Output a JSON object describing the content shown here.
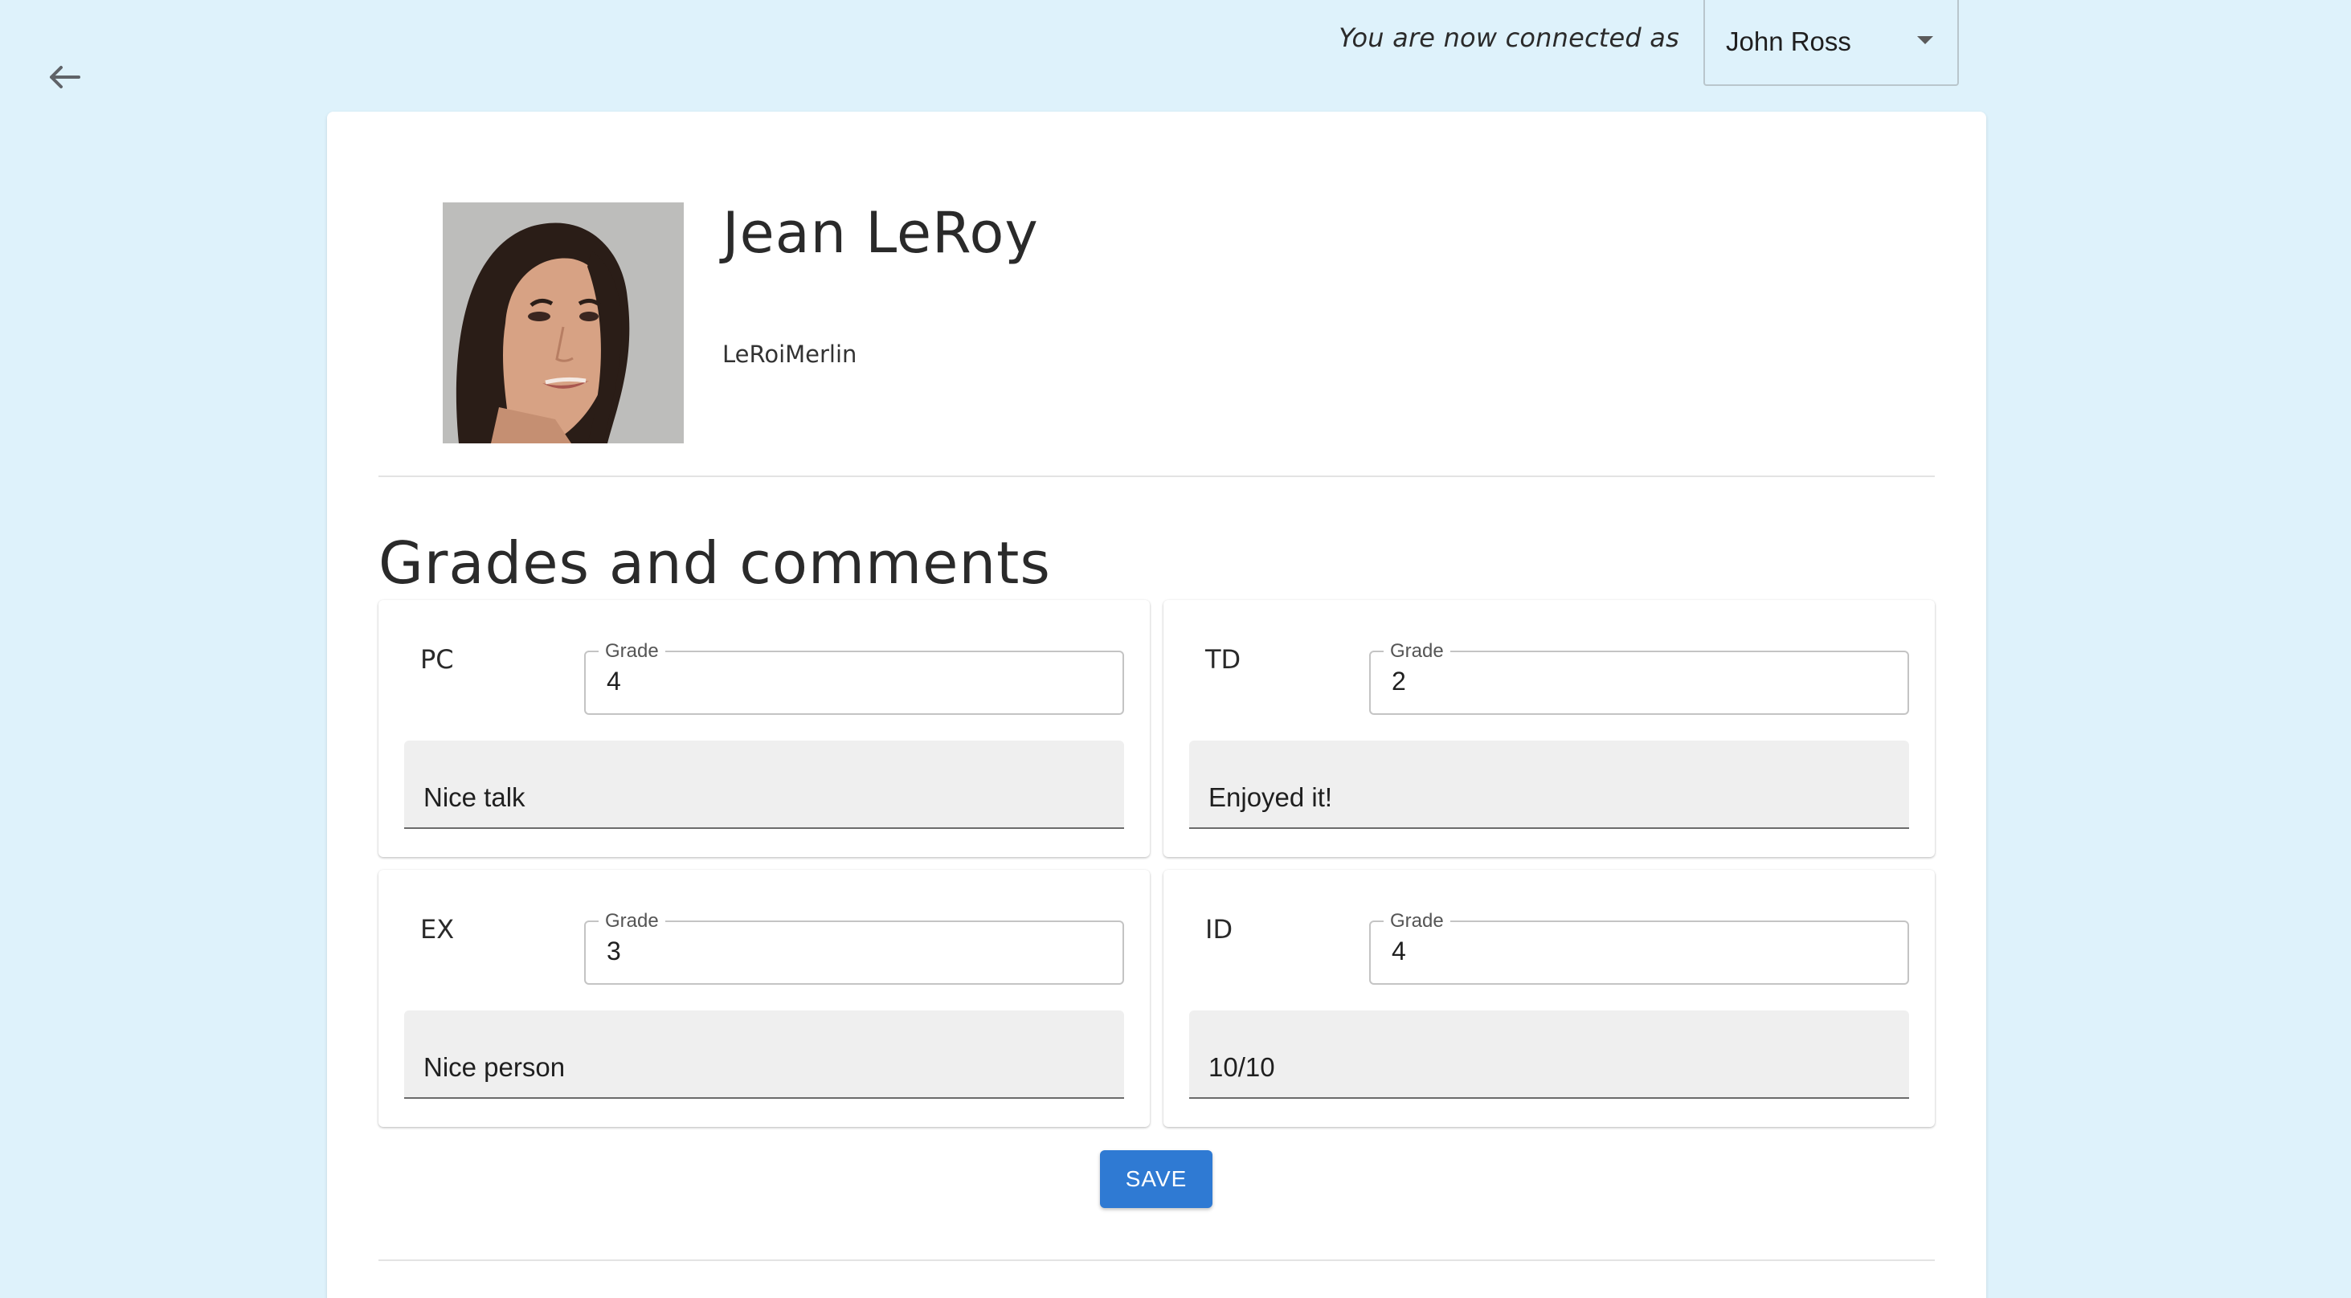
{
  "header": {
    "connected_label": "You are now connected as",
    "selected_user": "John Ross"
  },
  "profile": {
    "name": "Jean LeRoy",
    "username": "LeRoiMerlin"
  },
  "grades_section": {
    "title": "Grades and comments",
    "grade_label": "Grade",
    "cards": [
      {
        "course": "PC",
        "grade": "4",
        "comment": "Nice talk"
      },
      {
        "course": "TD",
        "grade": "2",
        "comment": "Enjoyed it!"
      },
      {
        "course": "EX",
        "grade": "3",
        "comment": "Nice person"
      },
      {
        "course": "ID",
        "grade": "4",
        "comment": "10/10"
      }
    ],
    "save_label": "SAVE"
  },
  "colors": {
    "page_background": "#def2fb",
    "accent": "#2f7ad3"
  }
}
